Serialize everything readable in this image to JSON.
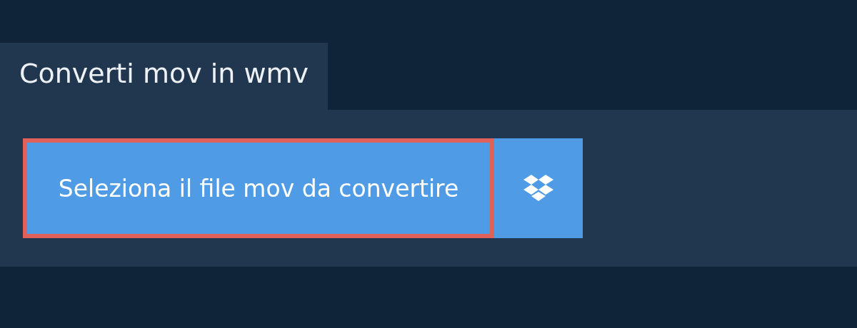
{
  "tab": {
    "label": "Converti mov in wmv",
    "selected": true
  },
  "select_button": {
    "label": "Seleziona il file mov da convertire",
    "highlighted": true
  },
  "cloud_button": {
    "kind": "dropbox"
  }
}
